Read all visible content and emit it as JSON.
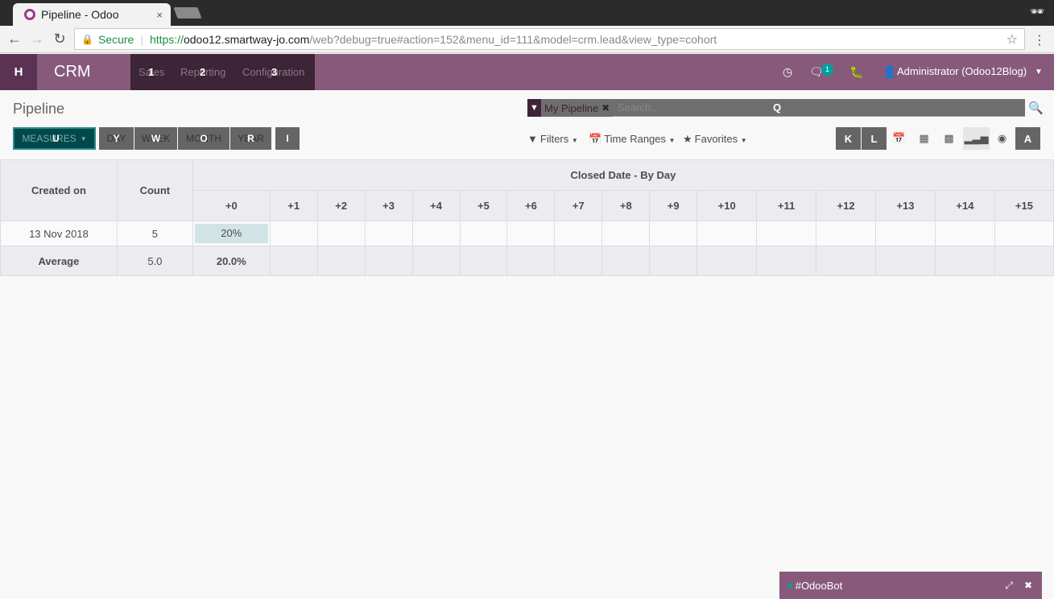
{
  "browser": {
    "tab_title": "Pipeline - Odoo",
    "tab_close": "×",
    "secure_label": "Secure",
    "url_scheme": "https://",
    "url_host": "odoo12.smartway-jo.com",
    "url_rest": "/web?debug=true#action=152&menu_id=111&model=crm.lead&view_type=cohort"
  },
  "navbar": {
    "apps_key": "H",
    "brand": "CRM",
    "menus": [
      {
        "label": "Sales",
        "key": "1"
      },
      {
        "label": "Reporting",
        "key": "2"
      },
      {
        "label": "Configuration",
        "key": "3"
      }
    ],
    "chat_badge": "1",
    "user": "Administrator (Odoo12Blog)"
  },
  "control_panel": {
    "title": "Pipeline",
    "facet_label": "My Pipeline",
    "search_placeholder": "Search...",
    "search_key": "Q",
    "measures_label": "MEASURES",
    "measures_key": "U",
    "intervals": [
      {
        "label": "DAY",
        "key": "Y"
      },
      {
        "label": "WEEK",
        "key": "W"
      },
      {
        "label": "MONTH",
        "key": "O"
      },
      {
        "label": "YEAR",
        "key": "R"
      }
    ],
    "download_key": "I",
    "filters": "Filters",
    "time_ranges": "Time Ranges",
    "favorites": "Favorites",
    "view_keys": {
      "kanban": "K",
      "list": "L",
      "activity": "A"
    }
  },
  "cohort": {
    "col_created": "Created on",
    "col_count": "Count",
    "group_header": "Closed Date - By Day",
    "periods": [
      "+0",
      "+1",
      "+2",
      "+3",
      "+4",
      "+5",
      "+6",
      "+7",
      "+8",
      "+9",
      "+10",
      "+11",
      "+12",
      "+13",
      "+14",
      "+15"
    ],
    "rows": [
      {
        "date": "13 Nov 2018",
        "count": "5",
        "first": "20%"
      }
    ],
    "average": {
      "label": "Average",
      "count": "5.0",
      "first": "20.0%"
    }
  },
  "chat": {
    "title": "#OdooBot"
  },
  "colors": {
    "odoo_purple": "#875a7b",
    "teal": "#00a09d"
  }
}
